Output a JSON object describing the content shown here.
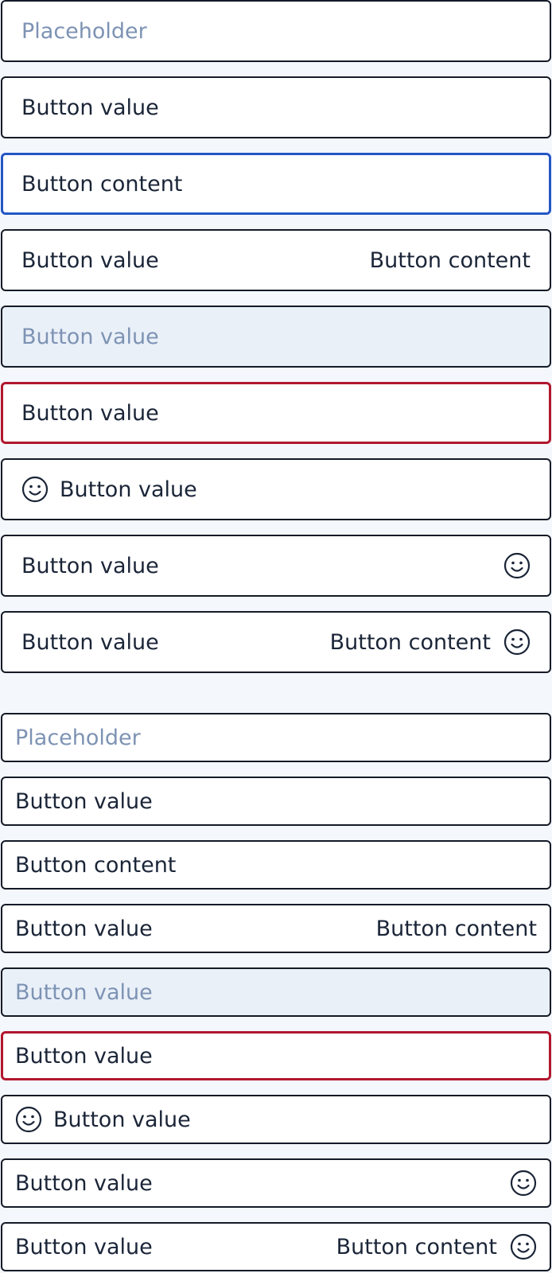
{
  "colors": {
    "page_background": "#f4f7fb",
    "text": "#1b2538",
    "placeholder": "#7d93b4",
    "border": "#141a26",
    "focus_border": "#2457c5",
    "error_border": "#b0182e",
    "disabled_background": "#eaf0f8"
  },
  "large": {
    "placeholder": {
      "text": "Placeholder"
    },
    "default": {
      "value": "Button value"
    },
    "focused": {
      "value": "Button content"
    },
    "with_content": {
      "value": "Button value",
      "content": "Button content"
    },
    "disabled": {
      "value": "Button value"
    },
    "error": {
      "value": "Button value"
    },
    "leading_icon": {
      "value": "Button value",
      "icon": "smiley-icon"
    },
    "trailing_icon": {
      "value": "Button value",
      "icon": "smiley-icon"
    },
    "content_trailing_icon": {
      "value": "Button value",
      "content": "Button content",
      "icon": "smiley-icon"
    }
  },
  "small": {
    "placeholder": {
      "text": "Placeholder"
    },
    "default": {
      "value": "Button value"
    },
    "plain": {
      "value": "Button content"
    },
    "with_content": {
      "value": "Button value",
      "content": "Button content"
    },
    "disabled": {
      "value": "Button value"
    },
    "error": {
      "value": "Button value"
    },
    "leading_icon": {
      "value": "Button value",
      "icon": "smiley-icon"
    },
    "trailing_icon": {
      "value": "Button value",
      "icon": "smiley-icon"
    },
    "content_trailing_icon": {
      "value": "Button value",
      "content": "Button content",
      "icon": "smiley-icon"
    }
  }
}
